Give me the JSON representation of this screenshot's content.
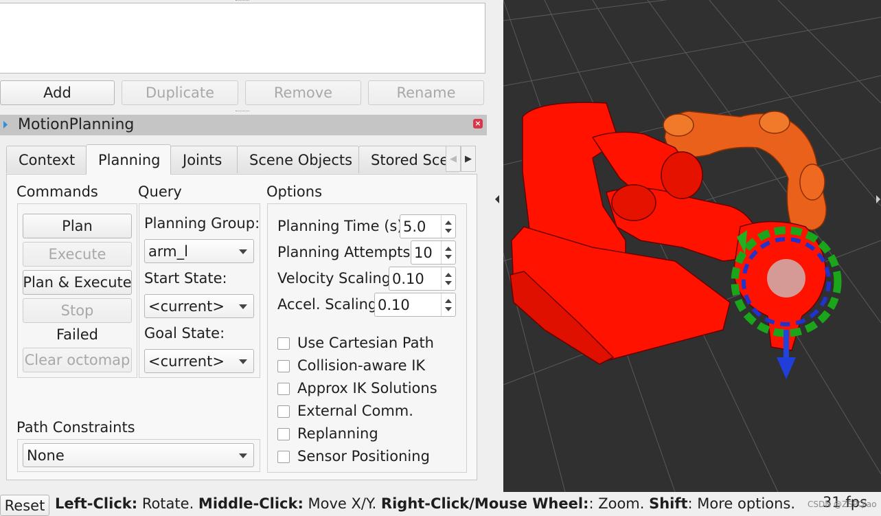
{
  "top_buttons": [
    {
      "label": "Add",
      "enabled": true
    },
    {
      "label": "Duplicate",
      "enabled": false
    },
    {
      "label": "Remove",
      "enabled": false
    },
    {
      "label": "Rename",
      "enabled": false
    }
  ],
  "dock": {
    "title": "MotionPlanning"
  },
  "tabs": [
    {
      "label": "Context"
    },
    {
      "label": "Planning"
    },
    {
      "label": "Joints"
    },
    {
      "label": "Scene Objects"
    },
    {
      "label": "Stored Sce"
    }
  ],
  "active_tab": "Planning",
  "commands": {
    "heading": "Commands",
    "buttons": [
      {
        "label": "Plan",
        "enabled": true
      },
      {
        "label": "Execute",
        "enabled": false
      },
      {
        "label": "Plan & Execute",
        "enabled": true
      },
      {
        "label": "Stop",
        "enabled": false
      }
    ],
    "status": "Failed",
    "clear_octomap": "Clear octomap"
  },
  "query": {
    "heading": "Query",
    "planning_group_label": "Planning Group:",
    "planning_group_value": "arm_l",
    "start_state_label": "Start State:",
    "start_state_value": "<current>",
    "goal_state_label": "Goal State:",
    "goal_state_value": "<current>"
  },
  "options": {
    "heading": "Options",
    "planning_time_label": "Planning Time (s):",
    "planning_time_value": "5.0",
    "planning_attempts_label": "Planning Attempts:",
    "planning_attempts_value": "10",
    "velocity_scaling_label": "Velocity Scaling:",
    "velocity_scaling_value": "0.10",
    "accel_scaling_label": "Accel. Scaling:",
    "accel_scaling_value": "0.10",
    "checkboxes": [
      {
        "label": "Use Cartesian Path",
        "checked": false
      },
      {
        "label": "Collision-aware IK",
        "checked": false
      },
      {
        "label": "Approx IK Solutions",
        "checked": false
      },
      {
        "label": "External Comm.",
        "checked": false
      },
      {
        "label": "Replanning",
        "checked": false
      },
      {
        "label": "Sensor Positioning",
        "checked": false
      }
    ]
  },
  "path_constraints": {
    "label": "Path Constraints",
    "value": "None"
  },
  "statusbar": {
    "reset": "Reset",
    "left_click_key": "Left-Click:",
    "left_click_text": " Rotate. ",
    "middle_click_key": "Middle-Click:",
    "middle_click_text": " Move X/Y. ",
    "right_click_key": "Right-Click/Mouse Wheel:",
    "right_click_text": ": Zoom. ",
    "shift_key": "Shift",
    "shift_text": ": More options.",
    "fps": "31 fps"
  },
  "watermark": "CSDN @ZSPQiao",
  "colors": {
    "viewport_bg": "#303030",
    "robot_current": "#ff1200",
    "robot_goal": "#f06010",
    "grid": "#5a5a5a"
  }
}
